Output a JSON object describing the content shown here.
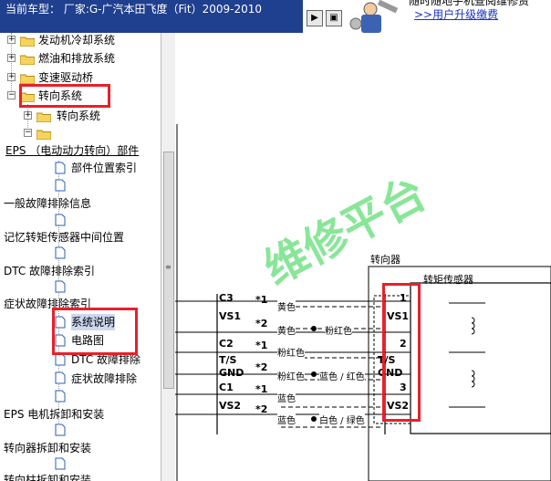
{
  "header": {
    "model_label": "当前车型：",
    "model_value": "厂家:G-广汽本田飞度（Fit）2009-2010",
    "nav_button_1": "▶",
    "nav_button_2": "▣",
    "upgrade_line1": "随时随地手机查阅维修资",
    "upgrade_link": ">>用户升级缴费"
  },
  "tree": {
    "items": [
      {
        "label": "发动机冷却系统"
      },
      {
        "label": "燃油和排放系统"
      },
      {
        "label": "变速驱动桥"
      },
      {
        "label": "转向系统"
      },
      {
        "label": "转向系统"
      },
      {
        "label": ""
      },
      {
        "label": "EPS （电动动力转向）部件"
      },
      {
        "label": "部件位置索引"
      },
      {
        "label": "一般故障排除信息"
      },
      {
        "label": "记忆转矩传感器中间位置"
      },
      {
        "label": "DTC 故障排除索引"
      },
      {
        "label": "症状故障排除索引"
      },
      {
        "label": "系统说明"
      },
      {
        "label": "电路图"
      },
      {
        "label": "DTC 故障排除"
      },
      {
        "label": "症状故障排除"
      },
      {
        "label": "EPS 电机拆卸和安装"
      },
      {
        "label": "转向器拆卸和安装"
      },
      {
        "label": "转向柱拆卸和安装"
      }
    ]
  },
  "diagram": {
    "watermark": "维修平台",
    "steering_gear_label": "转向器",
    "torque_sensor_label": "转矩传感器",
    "left_pins": [
      "C3",
      "VS1",
      "C2",
      "T/S",
      "GND",
      "C1",
      "VS2"
    ],
    "stars": [
      "*1",
      "*2",
      "*1",
      "*2",
      "*1",
      "*2"
    ],
    "wire_colors": [
      "黄色",
      "黄色",
      "粉红色",
      "粉红色",
      "粉红色",
      "蓝色 / 红色",
      "蓝色",
      "蓝色",
      "白色 / 绿色"
    ],
    "right_pins": [
      "1",
      "VS1",
      "2",
      "T/S",
      "GND",
      "3",
      "VS2"
    ]
  }
}
